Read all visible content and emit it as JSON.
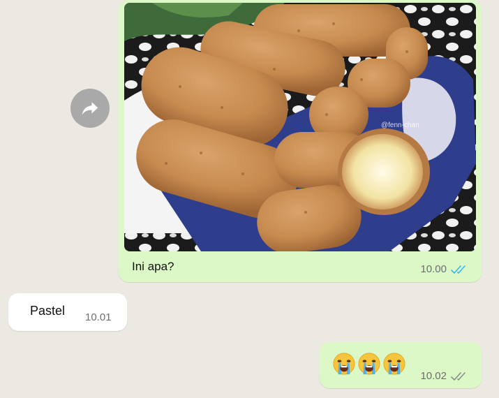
{
  "messages": {
    "image_message": {
      "caption": "Ini apa?",
      "time": "10.00",
      "status": "read",
      "watermark": "@fenn-chan"
    },
    "reply": {
      "text": "Pastel",
      "time": "10.01"
    },
    "emoji_message": {
      "emojis": [
        "crying-face-emoji",
        "crying-face-emoji",
        "crying-face-emoji"
      ],
      "time": "10.02",
      "status": "delivered"
    }
  },
  "colors": {
    "background": "#ece8e2",
    "outgoing_bubble": "#dcf8c6",
    "incoming_bubble": "#ffffff",
    "read_tick": "#34b7f1",
    "delivered_tick": "#8c8c8c"
  },
  "icons": {
    "forward": "forward-arrow-icon",
    "read_receipt": "double-check-icon"
  }
}
